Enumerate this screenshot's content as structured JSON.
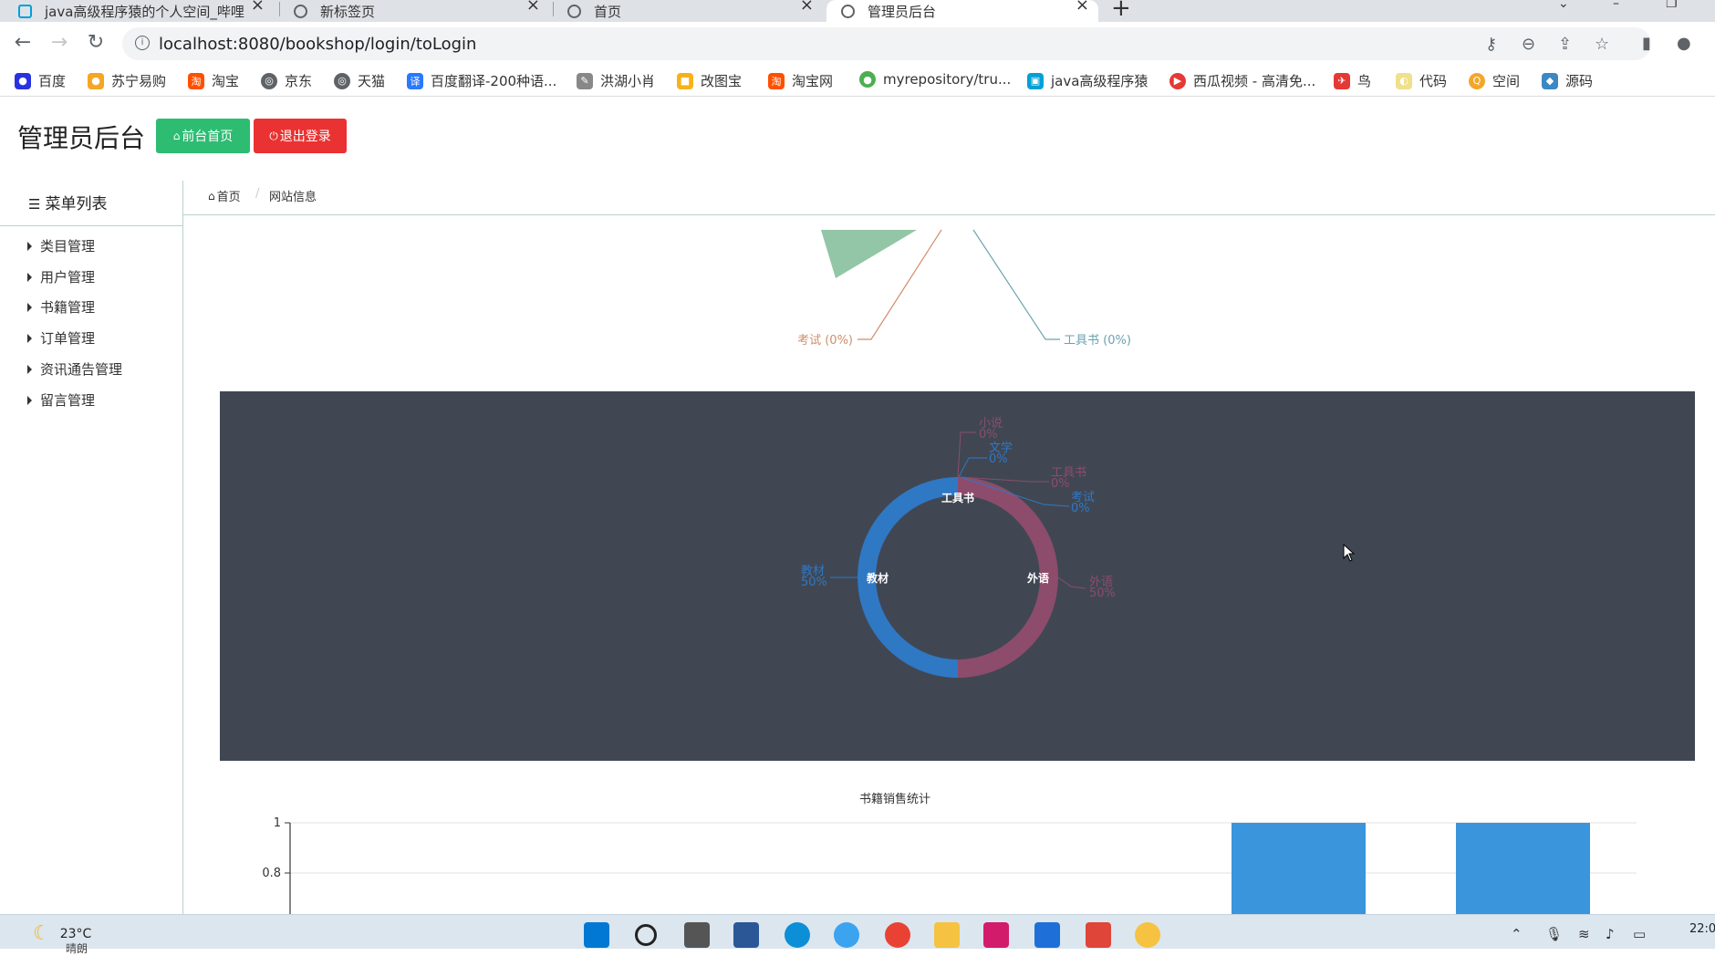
{
  "browser": {
    "tabs": [
      {
        "label": "java高级程序猿的个人空间_哔哩"
      },
      {
        "label": "新标签页"
      },
      {
        "label": "首页"
      },
      {
        "label": "管理员后台"
      }
    ],
    "url": "localhost:8080/bookshop/login/toLogin",
    "bookmarks": [
      "百度",
      "苏宁易购",
      "淘宝",
      "京东",
      "天猫",
      "百度翻译-200种语...",
      "洪湖小肖",
      "改图宝",
      "淘宝网",
      "myrepository/tru...",
      "java高级程序猿",
      "西瓜视频 - 高清免...",
      "鸟",
      "代码",
      "空间",
      "源码"
    ]
  },
  "header": {
    "title": "管理员后台",
    "front_button": "前台首页",
    "logout_button": "退出登录"
  },
  "sidebar": {
    "title": "菜单列表",
    "items": [
      "类目管理",
      "用户管理",
      "书籍管理",
      "订单管理",
      "资讯通告管理",
      "留言管理"
    ]
  },
  "breadcrumb": {
    "home": "首页",
    "current": "网站信息"
  },
  "top_pie": {
    "labels": [
      {
        "text": "考试 (0%)",
        "color": "#d08e6b"
      },
      {
        "text": "工具书 (0%)",
        "color": "#6aa2b0"
      }
    ]
  },
  "chart_data": [
    {
      "type": "pie",
      "slices": [
        {
          "name": "教材",
          "value": 50,
          "color": "#2f78c4"
        },
        {
          "name": "外语",
          "value": 50,
          "color": "#8d4c6b"
        },
        {
          "name": "小说",
          "value": 0,
          "color": "#8d4c6b"
        },
        {
          "name": "文学",
          "value": 0,
          "color": "#2f78c4"
        },
        {
          "name": "工具书",
          "value": 0,
          "color": "#8d4c6b"
        },
        {
          "name": "考试",
          "value": 0,
          "color": "#2f78c4"
        }
      ],
      "center_overlap_label": "工具书",
      "outer_labels": [
        {
          "name": "小说",
          "pct": "0%"
        },
        {
          "name": "文学",
          "pct": "0%"
        },
        {
          "name": "工具书",
          "pct": "0%"
        },
        {
          "name": "考试",
          "pct": "0%"
        },
        {
          "name": "教材",
          "pct": "50%"
        },
        {
          "name": "外语",
          "pct": "50%"
        }
      ],
      "background": "#404753"
    },
    {
      "type": "bar",
      "title": "书籍销售统计",
      "ytick_labels": [
        "1",
        "0.8"
      ],
      "ylim_visible": [
        0.6,
        1
      ],
      "values_visible": [
        1,
        1
      ],
      "bar_color": "#3a95dc"
    }
  ],
  "taskbar": {
    "temperature": "23°C",
    "condition": "晴朗",
    "time": "22:0"
  }
}
